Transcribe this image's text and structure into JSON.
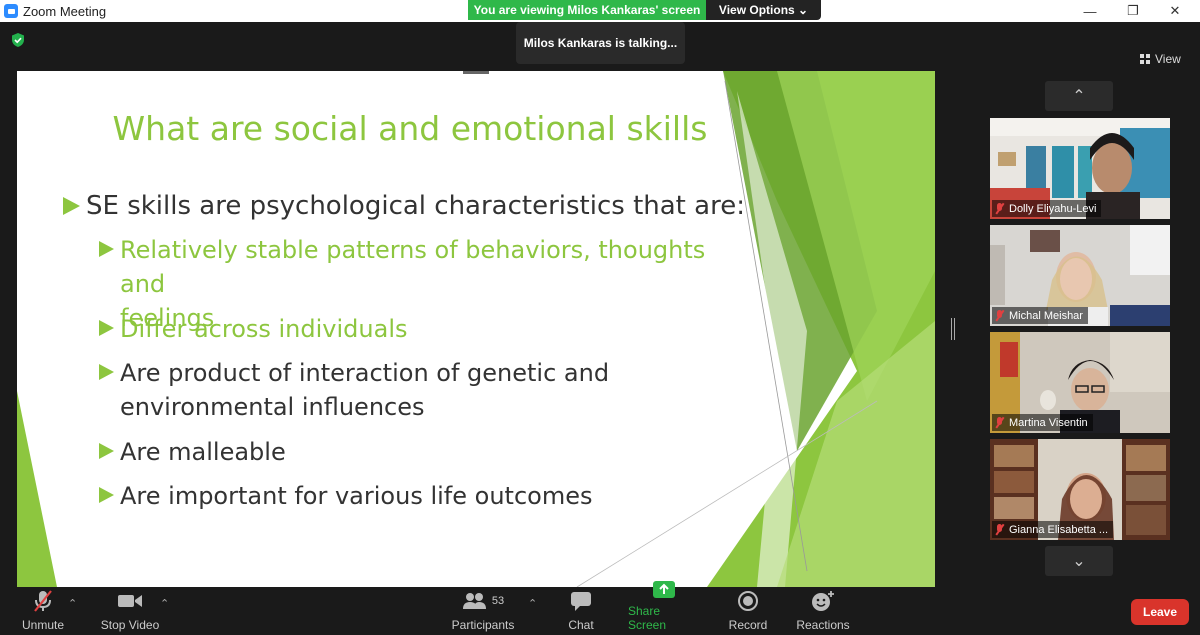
{
  "window": {
    "title": "Zoom Meeting",
    "minimize_icon": "minimize-icon",
    "maximize_icon": "restore-icon",
    "close_icon": "close-icon"
  },
  "banner": {
    "viewing": "You are viewing Milos Kankaras' screen",
    "view_options": "View Options ⌄"
  },
  "speaker_status": "Milos Kankaras is talking...",
  "view_button": "View",
  "slide": {
    "title": "What are social and emotional skills",
    "main_bullet": "SE skills are psychological characteristics that are:",
    "sub_bullets": [
      {
        "line1": "Relatively stable patterns of behaviors, thoughts and",
        "line2": "feelings",
        "accent": true
      },
      {
        "line1": "Differ across individuals",
        "line2": "",
        "accent": true
      },
      {
        "line1": "Are product of interaction of genetic and",
        "line2": "environmental influences",
        "accent": false
      },
      {
        "line1": "Are malleable",
        "line2": "",
        "accent": false
      },
      {
        "line1": "Are important for various life outcomes",
        "line2": "",
        "accent": false
      }
    ],
    "accent_color": "#8dc63f"
  },
  "participants_gallery": [
    {
      "name": "Dolly Eliyahu-Levi",
      "muted": true
    },
    {
      "name": "Michal Meishar",
      "muted": true
    },
    {
      "name": "Martina Visentin",
      "muted": true
    },
    {
      "name": "Gianna Elisabetta ...",
      "muted": true
    }
  ],
  "toolbar": {
    "unmute": "Unmute",
    "stop_video": "Stop Video",
    "participants": "Participants",
    "participants_count": "53",
    "chat": "Chat",
    "share_screen": "Share Screen",
    "record": "Record",
    "reactions": "Reactions",
    "leave": "Leave"
  },
  "colors": {
    "share_green": "#2fb84a",
    "leave_red": "#d9342b",
    "toolbar_bg": "#1a1a1a"
  }
}
